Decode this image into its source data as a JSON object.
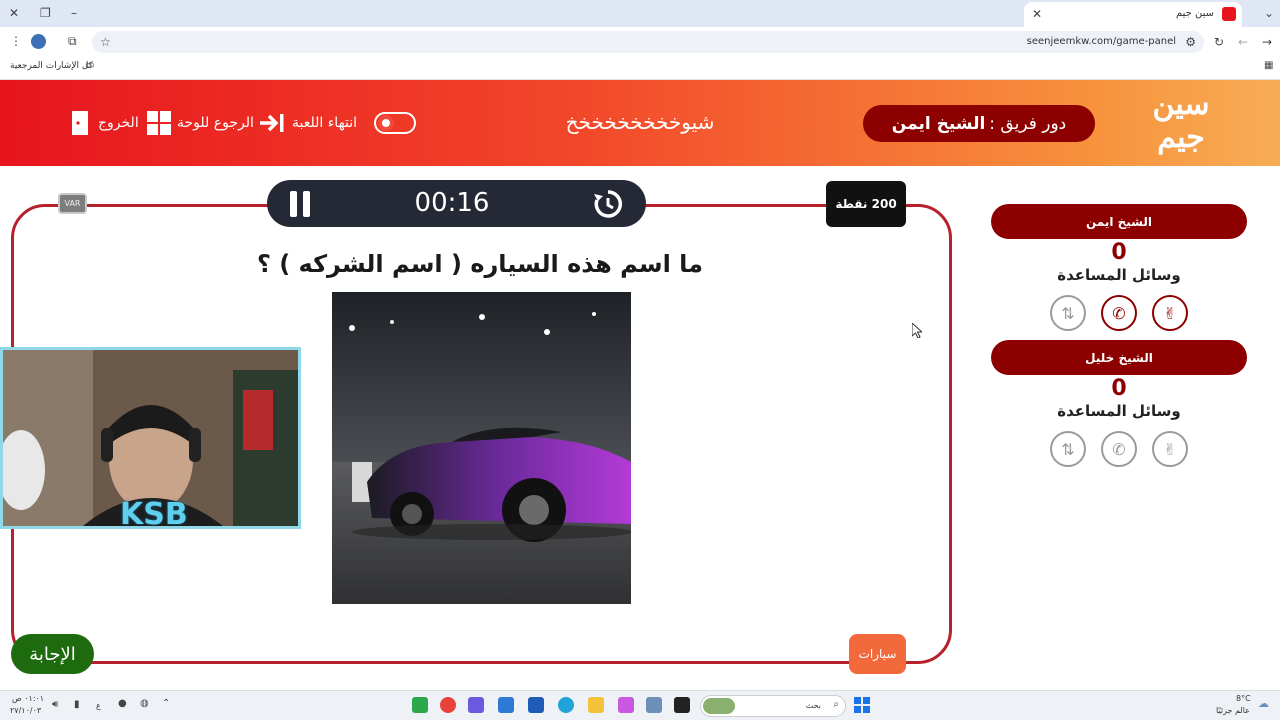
{
  "browser": {
    "tab_title": "سين جيم",
    "url": "seenjeemkw.com/game-panel",
    "bookmarks_label": "كل الإشارات المرجعية"
  },
  "header": {
    "logo_line1": "سين",
    "logo_line2": "جيم",
    "turn_prefix": "دور فريق :",
    "turn_team": "الشيخ ايمن",
    "game_name": "شيوخخخخخخخخخ",
    "end_game_label": "انتهاء اللعبة",
    "back_to_board_label": "الرجوع للوحة",
    "exit_label": "الخروج"
  },
  "game": {
    "timer": "00:16",
    "points": "200 نقطة",
    "var_label": "VAR",
    "question": "ما اسم هذه السياره ( اسم الشركه ) ؟",
    "answer_button": "الإجابة",
    "category": "سيارات",
    "overlay_logo": "KSB"
  },
  "teams": [
    {
      "name": "الشيخ ايمن",
      "score": "0",
      "help_label": "وسائل المساعدة",
      "aids": [
        {
          "icon": "peace-hand-icon",
          "active": true
        },
        {
          "icon": "phone-icon",
          "active": true
        },
        {
          "icon": "swap-icon",
          "active": false
        }
      ]
    },
    {
      "name": "الشيخ خليل",
      "score": "0",
      "help_label": "وسائل المساعدة",
      "aids": [
        {
          "icon": "peace-hand-icon",
          "active": false
        },
        {
          "icon": "phone-icon",
          "active": false
        },
        {
          "icon": "swap-icon",
          "active": false
        }
      ]
    }
  ],
  "taskbar": {
    "search_placeholder": "بحث",
    "weather_temp": "8°C",
    "weather_label": "عالم جزئيًا",
    "time": "٠١:٠١ ص",
    "date": "٢٧/١٠/٠٣",
    "lang": "ع"
  },
  "colors": {
    "header_start": "#e8141e",
    "header_end": "#f7ad55",
    "team_bar": "#8c0000",
    "answer_button": "#1e6a0f",
    "timer_bg": "#252935"
  }
}
